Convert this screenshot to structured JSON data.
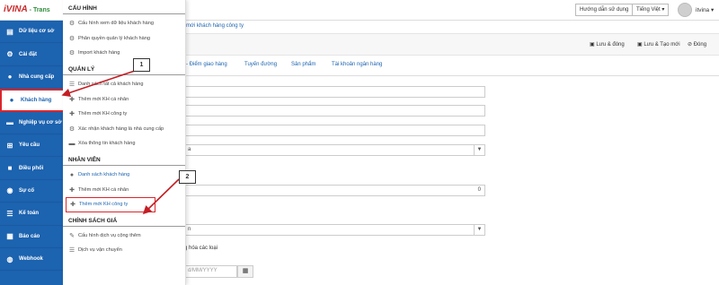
{
  "header": {
    "logo_main": "iVINA",
    "logo_sub": "- Trans",
    "guide_button": "Hướng dẫn sử dụng",
    "language": "Tiếng Việt ▾",
    "username": "itvina ▾"
  },
  "sidebar": {
    "items": [
      {
        "label": "Dữ liệu cơ sở",
        "icon": "grid-icon"
      },
      {
        "label": "Cài đặt",
        "icon": "gear-icon"
      },
      {
        "label": "Nhà cung cấp",
        "icon": "user-icon"
      },
      {
        "label": "Khách hàng",
        "icon": "user-icon"
      },
      {
        "label": "Nghiệp vụ cơ sở",
        "icon": "truck-icon"
      },
      {
        "label": "Yêu cầu",
        "icon": "cart-icon"
      },
      {
        "label": "Điều phối",
        "icon": "box-icon"
      },
      {
        "label": "Sự cố",
        "icon": "warning-icon"
      },
      {
        "label": "Kế toán",
        "icon": "list-icon"
      },
      {
        "label": "Báo cáo",
        "icon": "table-icon"
      },
      {
        "label": "Webhook",
        "icon": "globe-icon"
      }
    ]
  },
  "flyout": {
    "sections": [
      {
        "title": "CẤU HÌNH",
        "items": [
          "Cấu hình xem dữ liệu khách hàng",
          "Phân quyền quản lý khách hàng",
          "Import khách hàng"
        ]
      },
      {
        "title": "QUẢN LÝ",
        "items": [
          "Danh sách tất cả khách hàng",
          "Thêm mới KH cá nhân",
          "Thêm mới KH công ty",
          "Xác nhận khách hàng là nhà cung cấp",
          "Xóa thông tin khách hàng"
        ]
      },
      {
        "title": "NHÂN VIÊN",
        "items": [
          "Danh sách khách hàng",
          "Thêm mới KH cá nhân",
          "Thêm mới KH công ty"
        ]
      },
      {
        "title": "CHÍNH SÁCH GIÁ",
        "items": [
          "Cấu hình dịch vụ cộng thêm",
          "Dịch vụ vận chuyển"
        ]
      }
    ]
  },
  "main": {
    "breadcrumb": "mới khách hàng công ty",
    "toolbar": {
      "save_close": "Lưu & đóng",
      "save_new": "Lưu & Tạo mới",
      "close": "Đóng"
    },
    "tabs": [
      "- Điểm giao hàng",
      "Tuyến đường",
      "Sản phẩm",
      "Tài khoản ngân hàng"
    ],
    "fields": {
      "select_1_value": "a",
      "number_value": "0",
      "select_2_value": "n",
      "goods_text": "g hóa các loại",
      "date_placeholder": "d/MM/YYYY"
    }
  },
  "callouts": [
    "1",
    "2"
  ],
  "accent": {
    "sidebar_blue": "#1c63b0",
    "highlight_red": "#d9262d"
  }
}
